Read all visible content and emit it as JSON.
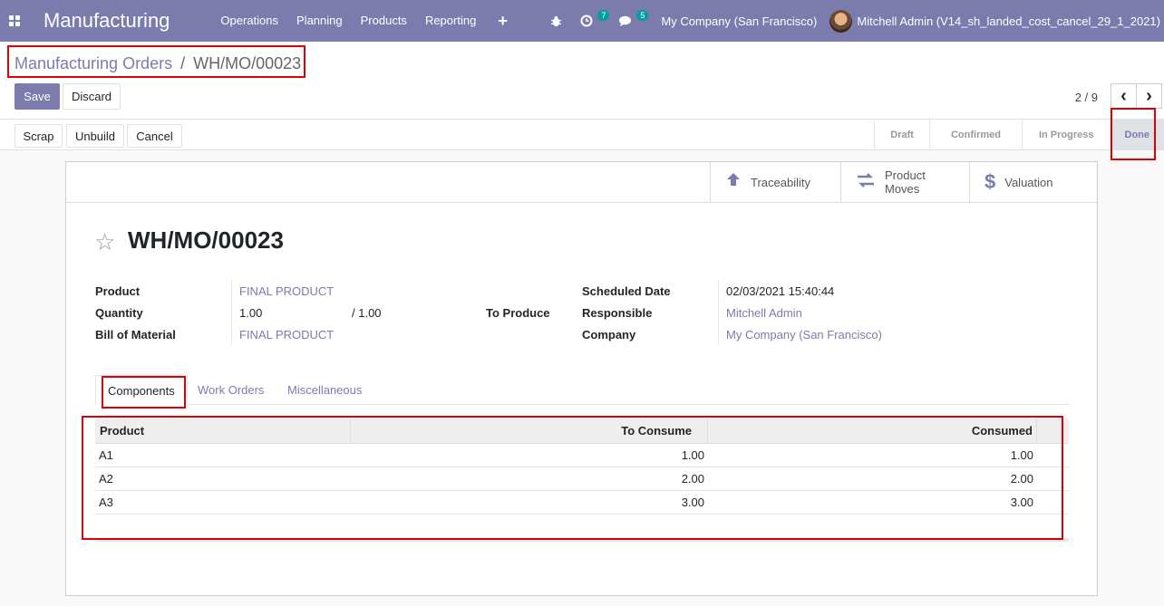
{
  "navbar": {
    "app_name": "Manufacturing",
    "menu": [
      "Operations",
      "Planning",
      "Products",
      "Reporting"
    ],
    "plus": "+",
    "activity_badge": "7",
    "message_badge": "5",
    "company": "My Company (San Francisco)",
    "user": "Mitchell Admin (V14_sh_landed_cost_cancel_29_1_2021)"
  },
  "breadcrumb": {
    "parent": "Manufacturing Orders",
    "sep": "/",
    "current": "WH/MO/00023"
  },
  "actions": {
    "save": "Save",
    "discard": "Discard"
  },
  "pager": {
    "value": "2 / 9",
    "prev": "‹",
    "next": "›"
  },
  "header_buttons": {
    "scrap": "Scrap",
    "unbuild": "Unbuild",
    "cancel": "Cancel"
  },
  "stages": [
    "Draft",
    "Confirmed",
    "In Progress",
    "Done"
  ],
  "active_stage": "Done",
  "smart_buttons": {
    "traceability": "Traceability",
    "product_moves": "Product Moves",
    "valuation": "Valuation"
  },
  "record": {
    "title": "WH/MO/00023",
    "product_label": "Product",
    "product": "FINAL PRODUCT",
    "quantity_label": "Quantity",
    "quantity": "1.00",
    "quantity_total": "/ 1.00",
    "to_produce": "To Produce",
    "bom_label": "Bill of Material",
    "bom": "FINAL PRODUCT",
    "scheduled_label": "Scheduled Date",
    "scheduled": "02/03/2021 15:40:44",
    "responsible_label": "Responsible",
    "responsible": "Mitchell Admin",
    "company_label": "Company",
    "company": "My Company (San Francisco)"
  },
  "tabs": {
    "components": "Components",
    "work_orders": "Work Orders",
    "misc": "Miscellaneous"
  },
  "components_table": {
    "headers": [
      "Product",
      "To Consume",
      "Consumed"
    ],
    "rows": [
      [
        "A1",
        "1.00",
        "1.00"
      ],
      [
        "A2",
        "2.00",
        "2.00"
      ],
      [
        "A3",
        "3.00",
        "3.00"
      ]
    ]
  },
  "colors": {
    "brand": "#7c7bad",
    "highlight": "#dd0000"
  }
}
